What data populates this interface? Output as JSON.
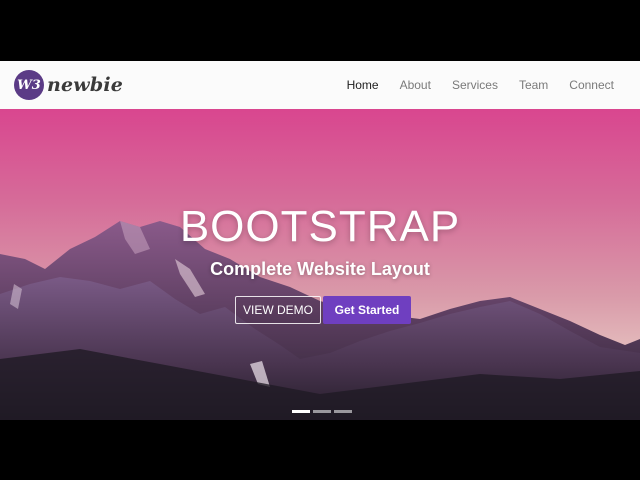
{
  "brand": {
    "badge": "W3",
    "name": "newbie"
  },
  "nav": {
    "items": [
      {
        "label": "Home",
        "active": true
      },
      {
        "label": "About",
        "active": false
      },
      {
        "label": "Services",
        "active": false
      },
      {
        "label": "Team",
        "active": false
      },
      {
        "label": "Connect",
        "active": false
      }
    ]
  },
  "hero": {
    "title": "BOOTSTRAP",
    "subtitle": "Complete Website Layout",
    "demo_button": "VIEW DEMO",
    "start_button": "Get Started",
    "carousel_slides": 3,
    "active_slide": 1
  },
  "colors": {
    "accent": "#6f3fc0",
    "logo_badge": "#5b3b86",
    "sky_top": "#d9468f",
    "sky_bottom": "#e4d4cc",
    "mountain": "#4a3550"
  },
  "icons": {
    "logo": "w3-badge-icon"
  }
}
